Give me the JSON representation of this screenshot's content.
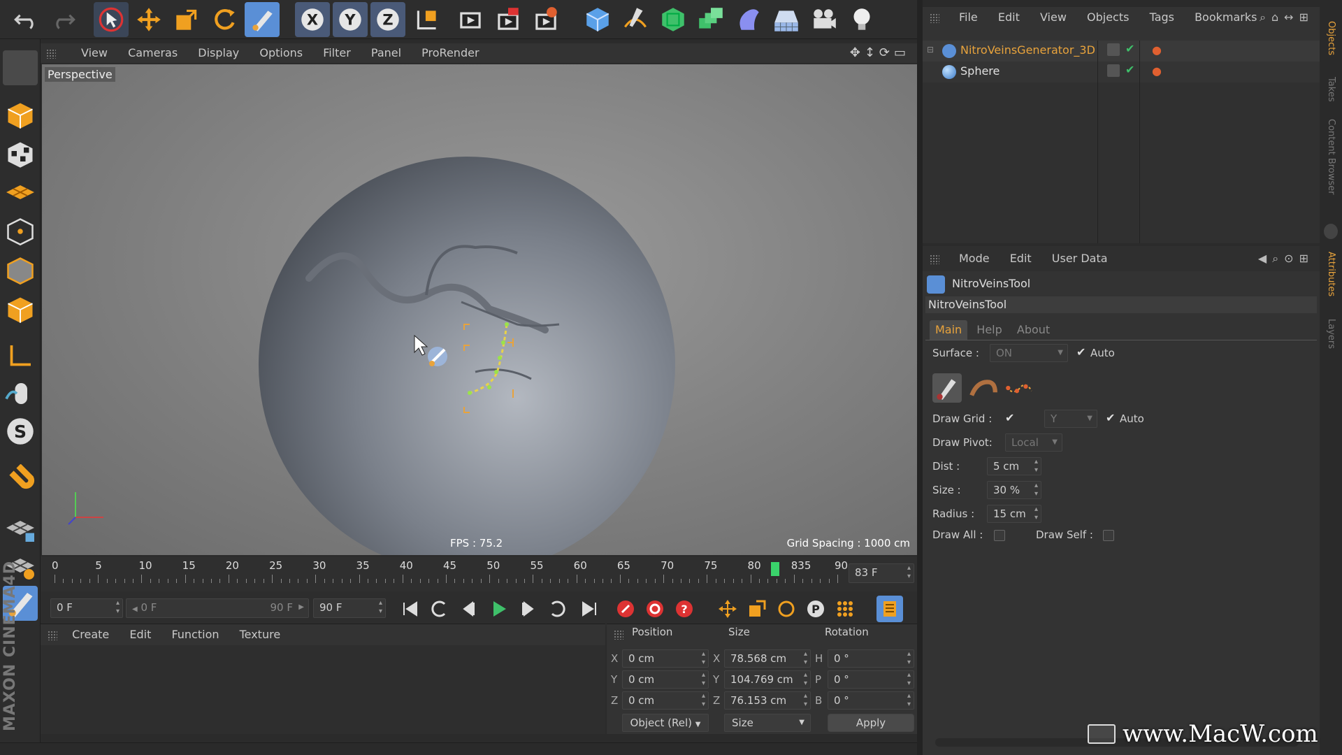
{
  "viewport": {
    "menu": [
      "View",
      "Cameras",
      "Display",
      "Options",
      "Filter",
      "Panel",
      "ProRender"
    ],
    "label": "Perspective",
    "fps": "FPS : 75.2",
    "grid_spacing": "Grid Spacing : 1000 cm"
  },
  "toolbar_icons": [
    "undo-icon",
    "redo-icon",
    "select-arrow-icon",
    "move-icon",
    "scale-icon",
    "rotate-icon",
    "veins-tool-icon",
    "x-axis-icon",
    "y-axis-icon",
    "z-axis-icon",
    "coordinate-system-icon",
    "render-view-icon",
    "render-picture-viewer-icon",
    "render-settings-icon",
    "cube-icon",
    "pen-icon",
    "subdivision-icon",
    "array-icon",
    "deformer-icon",
    "floor-icon",
    "camera-icon",
    "light-icon"
  ],
  "axis_letters": [
    "X",
    "Y",
    "Z"
  ],
  "timeline": {
    "ticks": [
      "0",
      "5",
      "10",
      "15",
      "20",
      "25",
      "30",
      "35",
      "40",
      "45",
      "50",
      "55",
      "60",
      "65",
      "70",
      "75",
      "80",
      "835",
      "90"
    ],
    "current_frame": "83 F",
    "start_field": "0 F",
    "range_start": "0 F",
    "range_end": "90 F",
    "end_field": "90 F"
  },
  "material_menu": [
    "Create",
    "Edit",
    "Function",
    "Texture"
  ],
  "coordinates": {
    "headers": {
      "position": "Position",
      "size": "Size",
      "rotation": "Rotation"
    },
    "rows": [
      {
        "axis": "X",
        "pos": "0 cm",
        "size_axis": "X",
        "size": "78.568 cm",
        "rot_axis": "H",
        "rot": "0 °"
      },
      {
        "axis": "Y",
        "pos": "0 cm",
        "size_axis": "Y",
        "size": "104.769 cm",
        "rot_axis": "P",
        "rot": "0 °"
      },
      {
        "axis": "Z",
        "pos": "0 cm",
        "size_axis": "Z",
        "size": "76.153 cm",
        "rot_axis": "B",
        "rot": "0 °"
      }
    ],
    "mode_select": "Object (Rel)",
    "size_select": "Size",
    "apply": "Apply"
  },
  "objects": {
    "menu": [
      "File",
      "Edit",
      "View",
      "Objects",
      "Tags",
      "Bookmarks"
    ],
    "items": [
      {
        "name": "NitroVeinsGenerator_3D",
        "color": "#e8a33c"
      },
      {
        "name": "Sphere",
        "color": "#d8d8d8"
      }
    ]
  },
  "attributes": {
    "menu": [
      "Mode",
      "Edit",
      "User Data"
    ],
    "tool_name": "NitroVeinsTool",
    "section": "NitroVeinsTool",
    "tabs": [
      "Main",
      "Help",
      "About"
    ],
    "surface_label": "Surface :",
    "surface_value": "ON",
    "auto1": "Auto",
    "draw_grid_label": "Draw Grid :",
    "grid_axis": "Y",
    "auto2": "Auto",
    "draw_pivot_label": "Draw Pivot:",
    "draw_pivot_value": "Local",
    "dist_label": "Dist :",
    "dist_value": "5 cm",
    "size_label": "Size :",
    "size_value": "30 %",
    "radius_label": "Radius :",
    "radius_value": "15 cm",
    "draw_all_label": "Draw All :",
    "draw_self_label": "Draw Self :"
  },
  "side_tabs": [
    "Objects",
    "Takes",
    "Content Browser",
    "Attributes",
    "Layers"
  ],
  "brand": "MAXON CINEMA4D",
  "watermark": "www.MacW.com",
  "colors": {
    "accent": "#e8a33c",
    "playhead": "#3ad36b",
    "active_tool": "#5a8fd6"
  }
}
